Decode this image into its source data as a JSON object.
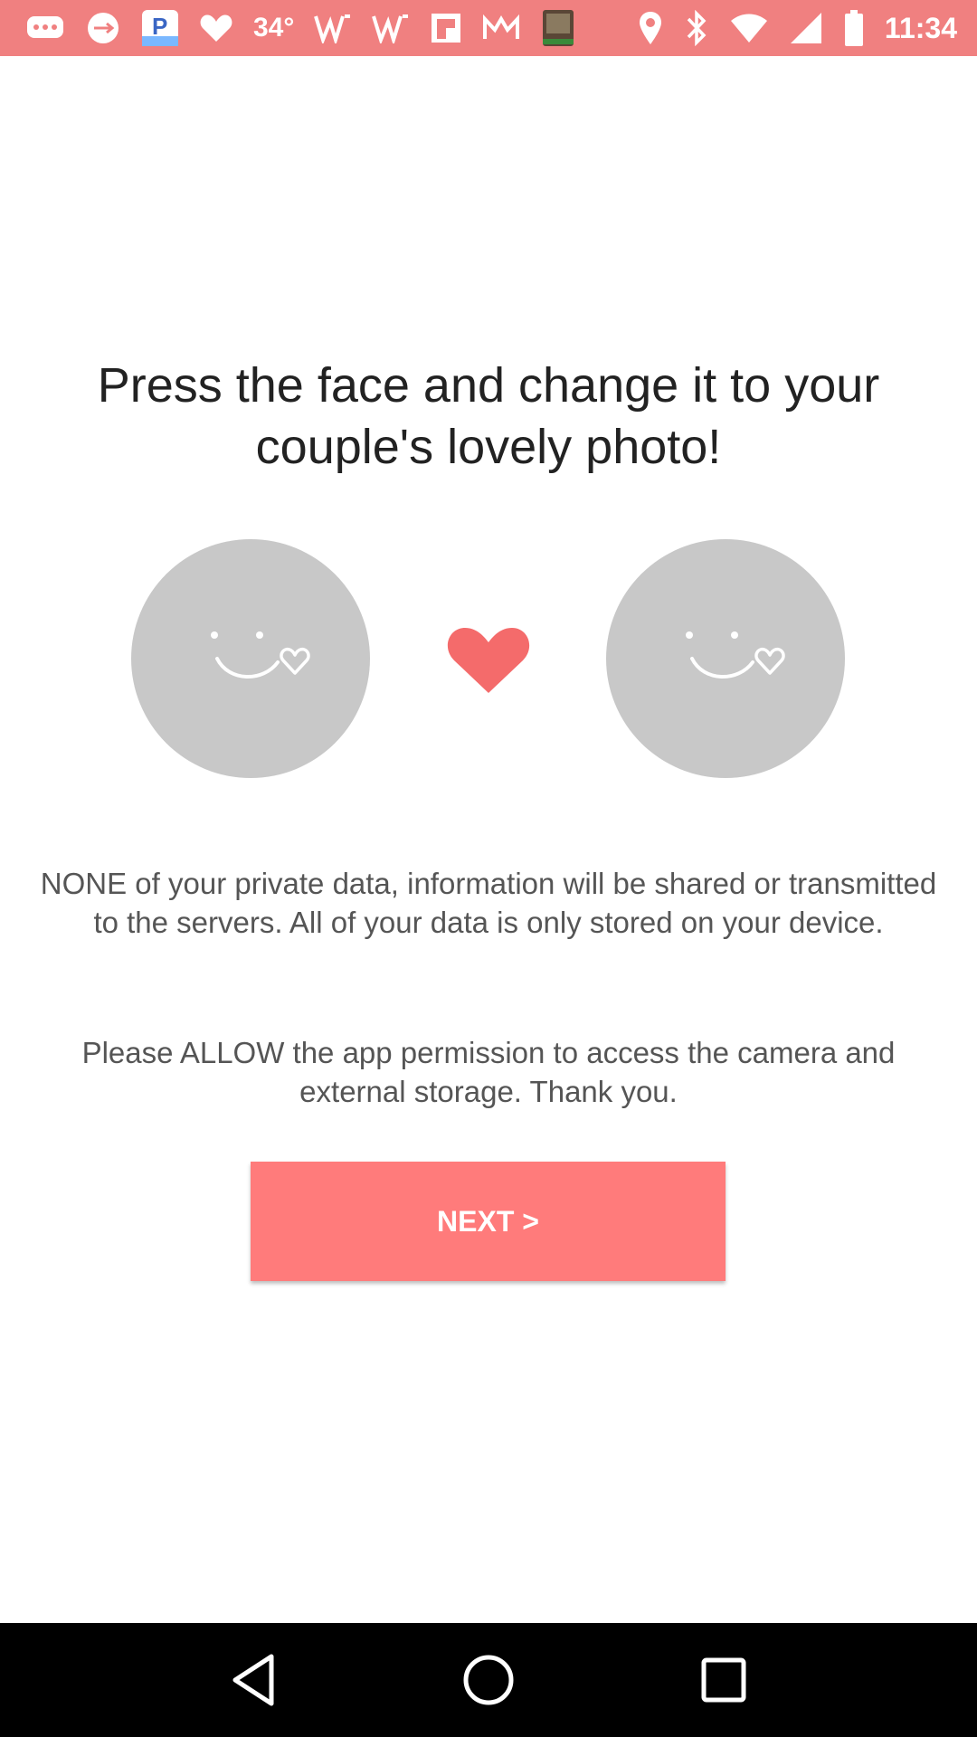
{
  "status_bar": {
    "temperature": "34°",
    "time": "11:34",
    "left_icons": [
      "messages-icon",
      "usb-icon",
      "p-app-icon",
      "heart-icon",
      "temperature",
      "w-icon",
      "w-icon",
      "flipboard-icon",
      "m-icon",
      "bible-icon"
    ],
    "right_icons": [
      "location-icon",
      "bluetooth-icon",
      "wifi-icon",
      "signal-icon",
      "battery-icon"
    ]
  },
  "main": {
    "title": "Press the face and change it to your couple's lovely photo!",
    "privacy_text": "NONE of your private data, information will be shared or transmitted to the servers. All of your data is only stored on your device.",
    "permission_text": "Please ALLOW the app permission to access the camera and external storage. Thank you.",
    "next_button_label": "NEXT >"
  },
  "colors": {
    "status_bar": "#f08080",
    "accent": "#ff7b7b",
    "heart": "#f46b6b",
    "face_placeholder": "#c8c8c8"
  }
}
